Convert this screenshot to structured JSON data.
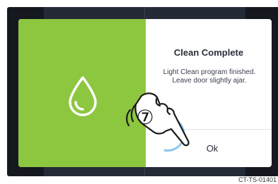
{
  "dialog": {
    "icon": "water-drop-icon",
    "title": "Clean Complete",
    "message": "Light Clean program finished. Leave door slightly ajar.",
    "ok_label": "Ok"
  },
  "annotation": {
    "step_number": "⑦",
    "gesture_icon": "tap-hand-icon"
  },
  "figure_id": "CT-TS-01401",
  "colors": {
    "accent_green": "#8dc63f",
    "screen_bg": "#15181f",
    "panel_bg": "#252a37",
    "tap_ring": "#8ec6ec"
  }
}
